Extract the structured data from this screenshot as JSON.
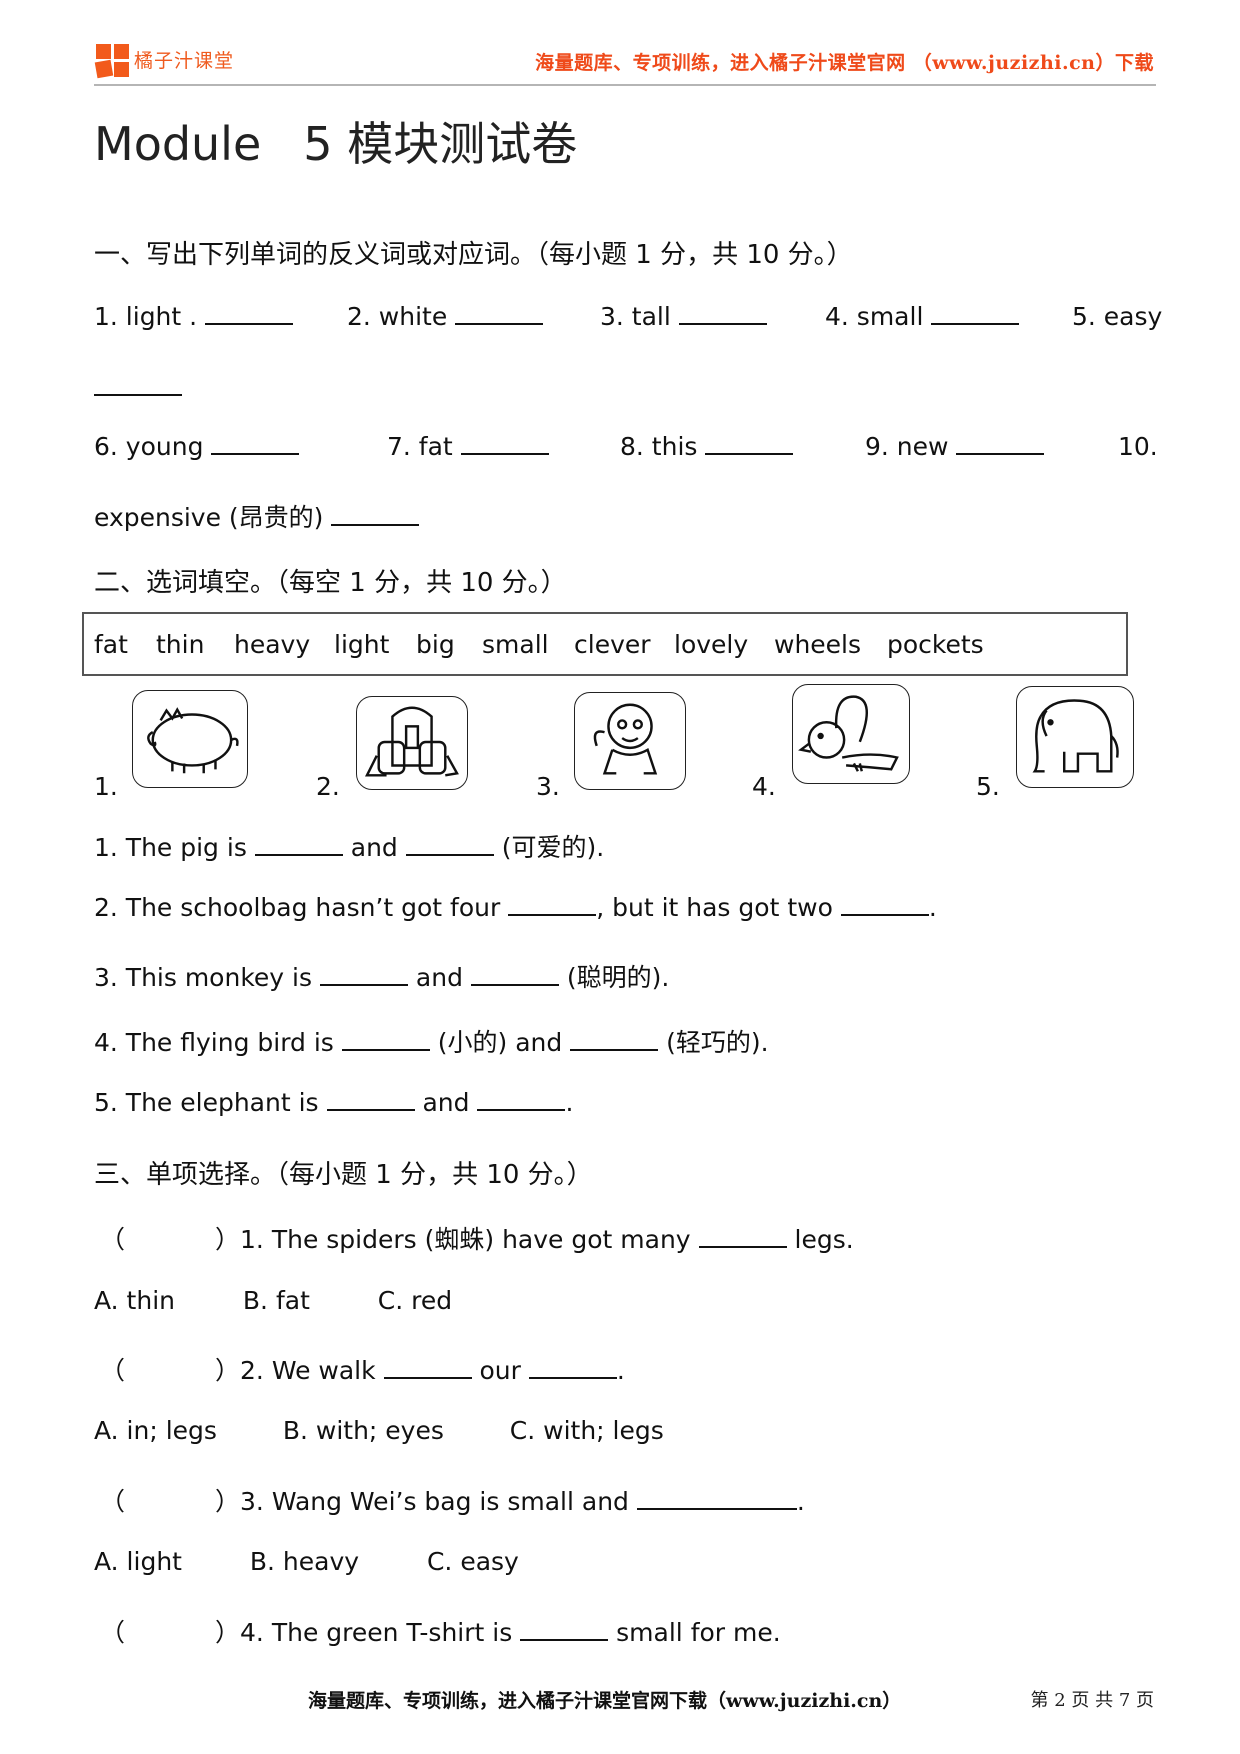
{
  "header": {
    "logo_text": "橘子汁课堂",
    "promo": "海量题库、专项训练，进入橘子汁课堂官网 （www.juzizhi.cn）下载",
    "brand_color": "#f25a1b"
  },
  "title": {
    "part1": "Module",
    "part2": "5",
    "part3": "模块测试卷"
  },
  "section1": {
    "heading": "一、写出下列单词的反义词或对应词。（每小题 1 分，共 10 分。）",
    "items": [
      {
        "label": "1. light ."
      },
      {
        "label": "2. white"
      },
      {
        "label": "3. tall"
      },
      {
        "label": "4. small"
      },
      {
        "label": "5. easy"
      },
      {
        "label": "6. young"
      },
      {
        "label": "7. fat"
      },
      {
        "label": "8. this"
      },
      {
        "label": "9. new"
      },
      {
        "label": "10."
      }
    ],
    "item10_cont": "expensive (昂贵的)"
  },
  "section2": {
    "heading": "二、选词填空。（每空 1 分，共 10 分。）",
    "word_bank": [
      "fat",
      "thin",
      "heavy",
      "light",
      "big",
      "small",
      "clever",
      "lovely",
      "wheels",
      "pockets"
    ],
    "pictures": [
      {
        "num": "1.",
        "icon": "pig-icon"
      },
      {
        "num": "2.",
        "icon": "schoolbag-icon"
      },
      {
        "num": "3.",
        "icon": "monkey-icon"
      },
      {
        "num": "4.",
        "icon": "bird-icon"
      },
      {
        "num": "5.",
        "icon": "elephant-icon"
      }
    ],
    "sentences": [
      {
        "a": "1. The pig is",
        "b": "and",
        "c": "(可爱的)."
      },
      {
        "a": "2. The schoolbag hasn’t got four",
        "b": ", but it has got two",
        "c": "."
      },
      {
        "a": "3. This monkey is",
        "b": "and",
        "c": "(聪明的)."
      },
      {
        "a": "4. The flying bird is",
        "b": "(小的) and",
        "c": "(轻巧的)."
      },
      {
        "a": "5. The elephant is",
        "b": "and",
        "c": "."
      }
    ]
  },
  "section3": {
    "heading": "三、单项选择。（每小题 1 分，共 10 分。）",
    "open_paren": "（",
    "close_paren": "）",
    "questions": [
      {
        "pre": "1. The spiders (蜘蛛) have got many",
        "post": "legs.",
        "options": [
          "A. thin",
          "B. fat",
          "C. red"
        ]
      },
      {
        "pre": "2. We walk",
        "mid": "our",
        "post": ".",
        "options": [
          "A. in; legs",
          "B. with; eyes",
          "C. with; legs"
        ]
      },
      {
        "pre": "3. Wang Wei’s bag is small and",
        "post": ".",
        "options": [
          "A. light",
          "B. heavy",
          "C. easy"
        ]
      },
      {
        "pre": "4. The green T-shirt is",
        "post": "small for me."
      }
    ]
  },
  "footer": {
    "promo": "海量题库、专项训练，进入橘子汁课堂官网下载（www.juzizhi.cn）",
    "page_info": "第 2 页 共 7 页"
  }
}
